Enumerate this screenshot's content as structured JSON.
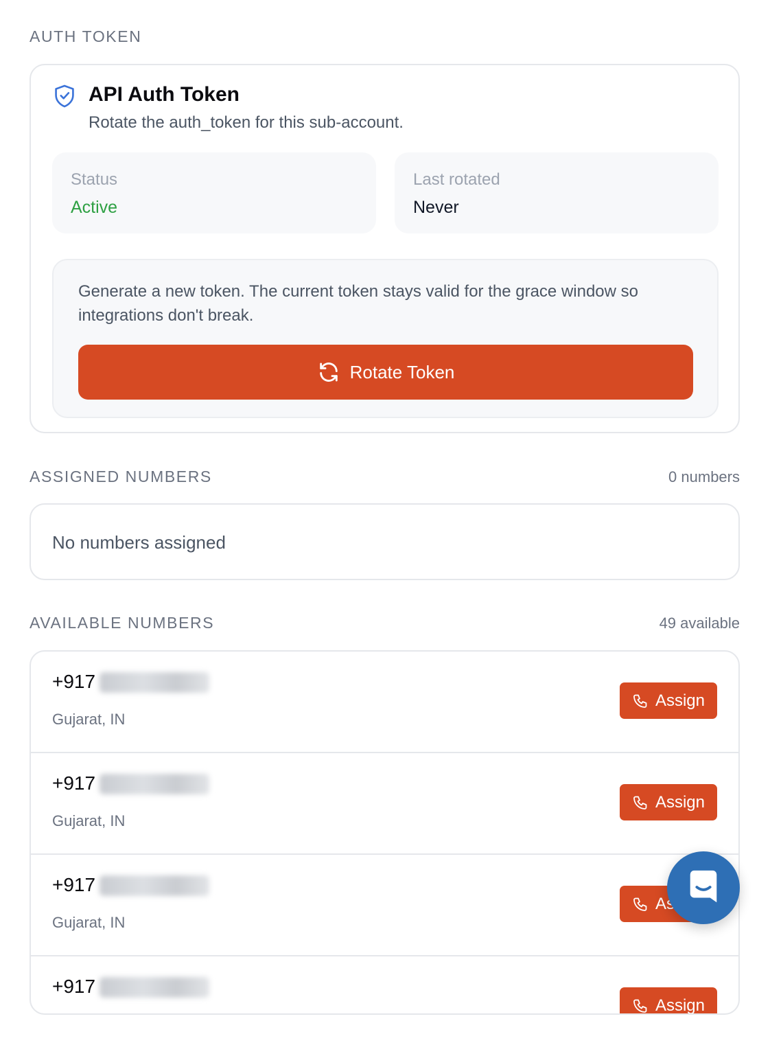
{
  "auth_section": {
    "label": "AUTH TOKEN"
  },
  "auth_card": {
    "title": "API Auth Token",
    "subtitle": "Rotate the auth_token for this sub-account.",
    "status": {
      "label": "Status",
      "value": "Active"
    },
    "last_rotated": {
      "label": "Last rotated",
      "value": "Never"
    },
    "rotate": {
      "description": "Generate a new token. The current token stays valid for the grace window so integrations don't break.",
      "button_label": "Rotate Token"
    }
  },
  "assigned_section": {
    "label": "ASSIGNED NUMBERS",
    "count": "0 numbers",
    "empty_text": "No numbers assigned"
  },
  "available_section": {
    "label": "AVAILABLE NUMBERS",
    "count": "49 available",
    "numbers": [
      {
        "prefix": "+917",
        "location": "Gujarat, IN",
        "button_label": "Assign"
      },
      {
        "prefix": "+917",
        "location": "Gujarat, IN",
        "button_label": "Assign"
      },
      {
        "prefix": "+917",
        "location": "Gujarat, IN",
        "button_label": "Assign"
      },
      {
        "prefix": "+917",
        "location": "",
        "button_label": "Assign"
      }
    ]
  },
  "colors": {
    "accent": "#d64a23",
    "status_active": "#2ea043",
    "chat": "#2e6fb5"
  }
}
